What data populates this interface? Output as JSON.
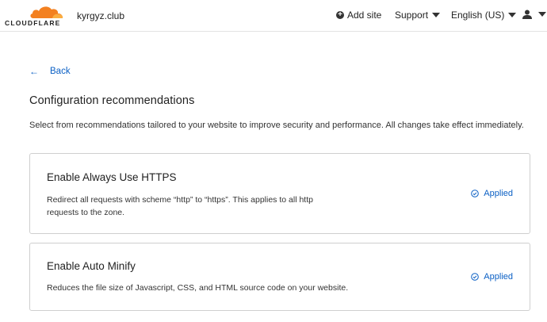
{
  "header": {
    "logo_text": "CLOUDFLARE",
    "site_name": "kyrgyz.club",
    "add_site_label": "Add site",
    "support_label": "Support",
    "language_label": "English (US)",
    "brand_color": "#f38020"
  },
  "main": {
    "back_label": "Back",
    "title": "Configuration recommendations",
    "description": "Select from recommendations tailored to your website to improve security and performance. All changes take effect immediately."
  },
  "recommendations": [
    {
      "title": "Enable Always Use HTTPS",
      "description": "Redirect all requests with scheme “http” to “https”. This applies to all http requests to the zone.",
      "status": "Applied"
    },
    {
      "title": "Enable Auto Minify",
      "description": "Reduces the file size of Javascript, CSS, and HTML source code on your website.",
      "status": "Applied"
    }
  ],
  "colors": {
    "link": "#0a5fc4",
    "border": "#cfcfcf"
  }
}
